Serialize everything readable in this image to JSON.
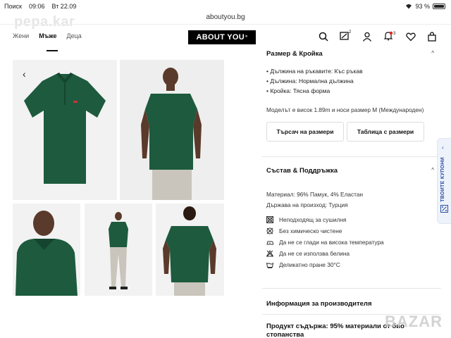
{
  "status_bar": {
    "back_app": "Поиск",
    "time": "09:06",
    "date": "Вт 22.09",
    "battery": "93 %",
    "battery_level": 0.93
  },
  "browser": {
    "url": "aboutyou.bg"
  },
  "watermark": "pepa.kar",
  "header": {
    "nav": [
      {
        "label": "Жени",
        "active": false
      },
      {
        "label": "Мъже",
        "active": true
      },
      {
        "label": "Деца",
        "active": false
      }
    ],
    "logo": "ABOUT YOU",
    "notification_badge": "3",
    "compare_badge": "2",
    "icons": [
      "search-icon",
      "compare-icon",
      "account-icon",
      "notification-icon",
      "wishlist-icon",
      "bag-icon"
    ]
  },
  "size_fit": {
    "title": "Размер & Кройка",
    "bullets": [
      "• Дължина на ръкавите: Къс ръкав",
      "• Дължина: Нормална дължина",
      "• Кройка: Тясна форма"
    ],
    "model_note": "Моделът е висок 1.89m и носи размер M (Международен)",
    "size_finder": "Търсач на размери",
    "size_table": "Таблица с размери"
  },
  "composition": {
    "title": "Състав & Поддръжка",
    "material": "Материал: 96% Памук, 4% Еластан",
    "origin": "Държава на произход: Турция",
    "care": [
      {
        "icon": "no-dryer-icon",
        "text": "Неподходящ за сушилня"
      },
      {
        "icon": "no-dry-clean-icon",
        "text": "Без химическо чистене"
      },
      {
        "icon": "low-iron-icon",
        "text": "Да не се глади на висока температура"
      },
      {
        "icon": "no-bleach-icon",
        "text": "Да не се използва белина"
      },
      {
        "icon": "wash-30-icon",
        "text": "Деликатно пране 30°C"
      }
    ]
  },
  "manufacturer": {
    "title": "Информация за производителя"
  },
  "product_content": {
    "title": "Продукт съдържа: 95% материали от био стопанства"
  },
  "coupons_tab": "ТВОИТЕ КУПОНИ",
  "bazar_watermark": "BAZAR",
  "colors": {
    "shirt": "#1d5a3e",
    "shirt_dark": "#15452f",
    "accent": "#2b4ea0"
  }
}
